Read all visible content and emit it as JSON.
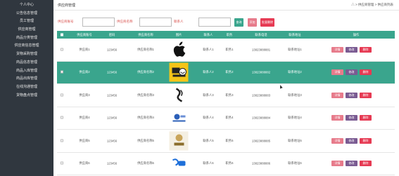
{
  "sidebar": {
    "items": [
      {
        "label": "个人中心"
      },
      {
        "label": "公告信息管理"
      },
      {
        "label": "员工管理"
      },
      {
        "label": "供应商管理"
      },
      {
        "label": "商品分类管理"
      },
      {
        "label": "供应商信息管理"
      },
      {
        "label": "货物采购管理"
      },
      {
        "label": "商品信息管理"
      },
      {
        "label": "商品入库管理"
      },
      {
        "label": "商品出库管理"
      },
      {
        "label": "在线沟通管理"
      },
      {
        "label": "货物盘点管理"
      }
    ]
  },
  "header": {
    "title": "供应商管理",
    "breadcrumb": "△ > 供应商管理 > 供应商列表"
  },
  "search": {
    "label1": "供应商账号",
    "label2": "供应商名称",
    "label3": "联系人",
    "search_btn": "查询",
    "add_btn": "添加",
    "batch_delete_btn": "批量删除"
  },
  "table": {
    "headers": [
      "",
      "供应商账号",
      "密码",
      "供应商名称",
      "图片",
      "联系人",
      "职务",
      "联系电话",
      "联系地址",
      "操作"
    ],
    "rows": [
      {
        "account": "供应商1",
        "password": "123456",
        "name": "供应商名称1",
        "logo": "apple-logo",
        "contact": "联系人1",
        "job": "职务1",
        "phone": "13823888881",
        "address": "联系地址1"
      },
      {
        "account": "供应商2",
        "password": "123456",
        "name": "供应商名称2",
        "logo": "yellow-brand-logo",
        "contact": "联系人2",
        "job": "职务2",
        "phone": "13823888882",
        "address": "联系地址2"
      },
      {
        "account": "供应商3",
        "password": "123456",
        "name": "供应商名称3",
        "logo": "swoosh-logo",
        "contact": "联系人3",
        "job": "职务3",
        "phone": "13823888883",
        "address": "联系地址3"
      },
      {
        "account": "供应商4",
        "password": "123456",
        "name": "供应商名称4",
        "logo": "badge-logo",
        "contact": "联系人4",
        "job": "职务4",
        "phone": "13823888884",
        "address": "联系地址4"
      },
      {
        "account": "供应商5",
        "password": "123456",
        "name": "供应商名称5",
        "logo": "bakery-logo",
        "contact": "联系人5",
        "job": "职务5",
        "phone": "13823888885",
        "address": "联系地址5"
      },
      {
        "account": "供应商6",
        "password": "123456",
        "name": "供应商名称6",
        "logo": "blue-brand-logo",
        "contact": "联系人6",
        "job": "职务6",
        "phone": "13823888886",
        "address": "联系地址6"
      }
    ],
    "op_detail": "详情",
    "op_edit": "修改",
    "op_delete": "删除"
  },
  "colors": {
    "sidebar_bg": "#30373f",
    "table_header": "#3aa58d",
    "active_row": "#3aa58d",
    "search_btn": "#3aa58d",
    "add_btn": "#e77b8b",
    "delete_btn": "#e63a53",
    "edit_btn": "#7a5b92"
  }
}
